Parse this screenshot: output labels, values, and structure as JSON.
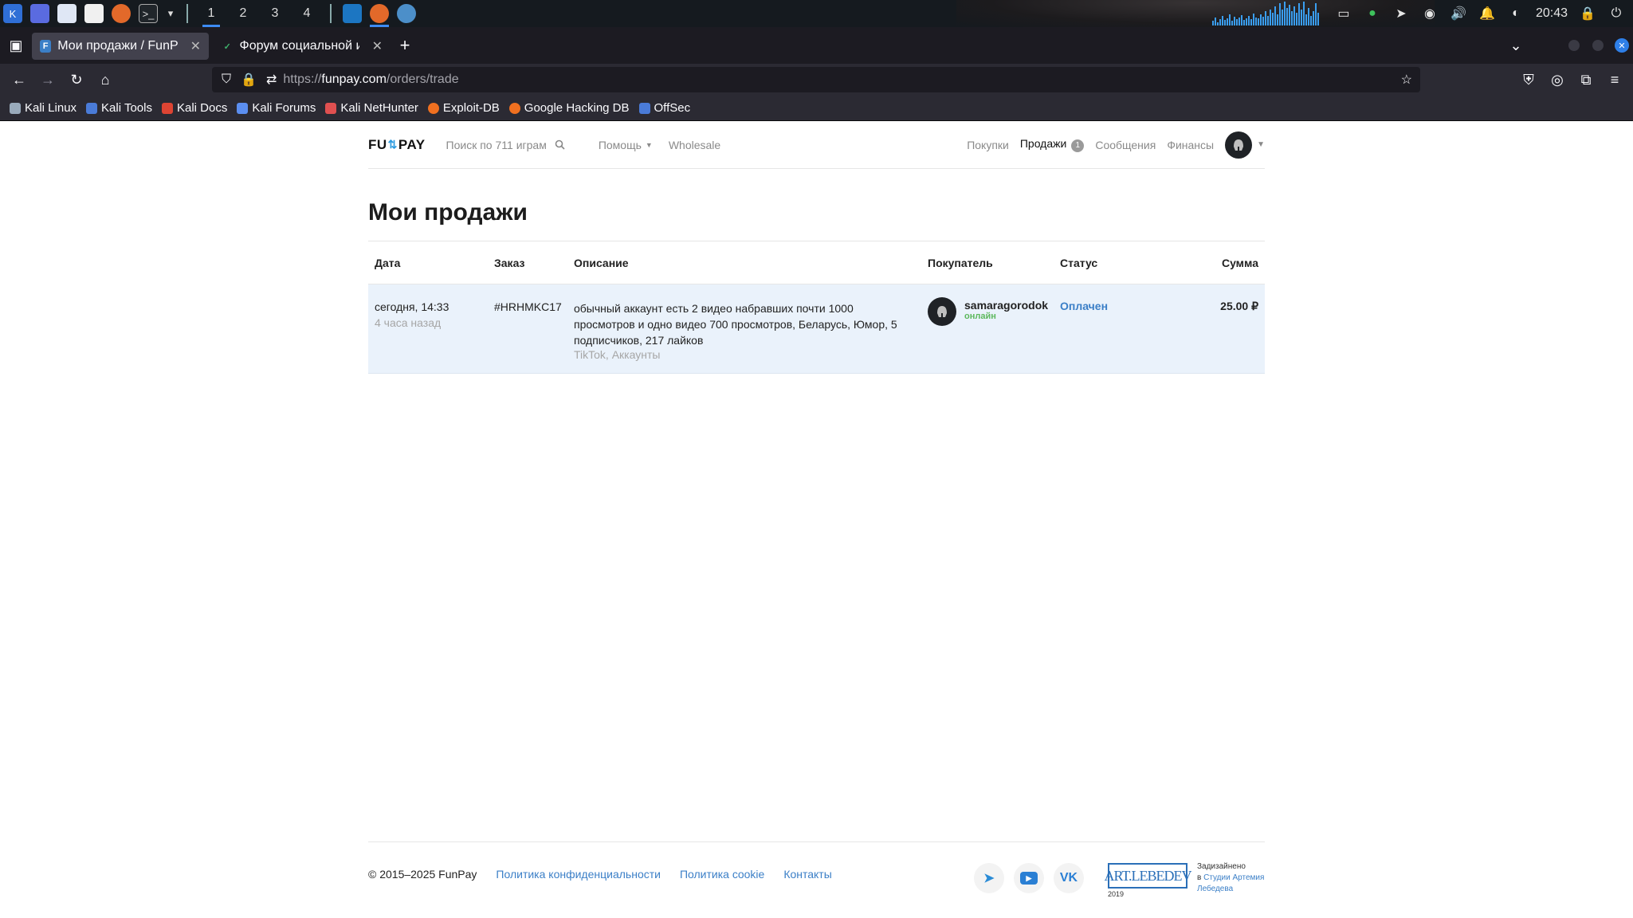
{
  "taskbar": {
    "workspaces": [
      "1",
      "2",
      "3",
      "4"
    ],
    "active_workspace": "1",
    "clock": "20:43",
    "accent": "#3d8bf3"
  },
  "browser": {
    "tabs": [
      {
        "favicon": "F",
        "title": "Мои продажи / FunPay",
        "active": true
      },
      {
        "favicon": "✓",
        "title": "Форум социальной инже",
        "active": false
      }
    ],
    "url_prefix": "https://",
    "url_host": "funpay.com",
    "url_path": "/orders/trade",
    "bookmarks": [
      {
        "label": "Kali Linux",
        "color": "#9ab"
      },
      {
        "label": "Kali Tools",
        "color": "#4a7bd8"
      },
      {
        "label": "Kali Docs",
        "color": "#d43"
      },
      {
        "label": "Kali Forums",
        "color": "#5b8ef0"
      },
      {
        "label": "Kali NetHunter",
        "color": "#e05050"
      },
      {
        "label": "Exploit-DB",
        "color": "#f07020"
      },
      {
        "label": "Google Hacking DB",
        "color": "#f07020"
      },
      {
        "label": "OffSec",
        "color": "#4a7bd8"
      }
    ]
  },
  "site": {
    "logo": {
      "left": "FU",
      "arrow": "⇅",
      "right": "PAY"
    },
    "search_label": "Поиск по 711 играм",
    "help_label": "Помощь",
    "wholesale_label": "Wholesale",
    "nav": {
      "purchases": "Покупки",
      "sales": "Продажи",
      "sales_badge": "1",
      "messages": "Сообщения",
      "finance": "Финансы"
    },
    "page_title": "Мои продажи",
    "table": {
      "headers": {
        "date": "Дата",
        "order": "Заказ",
        "description": "Описание",
        "buyer": "Покупатель",
        "status": "Статус",
        "sum": "Сумма"
      },
      "rows": [
        {
          "date": "сегодня, 14:33",
          "ago": "4 часа назад",
          "order": "#HRHMKC17",
          "description": "обычный аккаунт есть 2 видео набравших почти 1000 просмотров и одно видео 700 просмотров, Беларусь, Юмор, 5 подписчиков, 217 лайков",
          "category": "TikTok, Аккаунты",
          "buyer": "samaragorodok",
          "buyer_status": "онлайн",
          "status": "Оплачен",
          "sum": "25.00 ₽"
        }
      ]
    },
    "footer": {
      "copyright": "© 2015–2025 FunPay",
      "links": [
        "Политика конфиденциальности",
        "Политика cookie",
        "Контакты"
      ],
      "artlebedev_logo": "ART.LEBEDEV",
      "artlebedev_year": "2019",
      "credit_line1": "Задизайнено",
      "credit_line2": "в",
      "credit_link": "Студии Артемия Лебедева"
    },
    "colors": {
      "link": "#3b7fc7",
      "row_highlight": "#eaf2fb",
      "online": "#5cb85c"
    }
  }
}
